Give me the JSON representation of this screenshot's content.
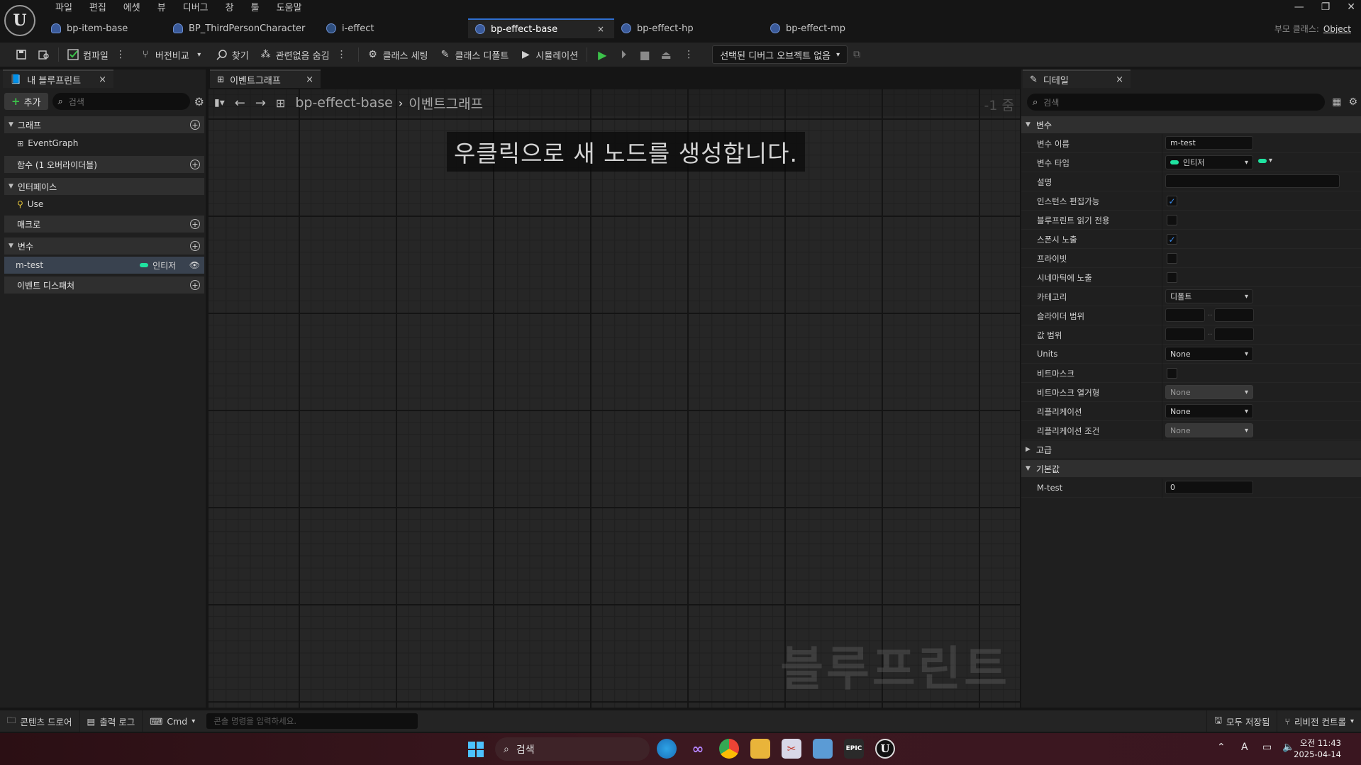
{
  "menu": [
    "파일",
    "편집",
    "에셋",
    "뷰",
    "디버그",
    "창",
    "툴",
    "도움말"
  ],
  "logo": "U",
  "doc_tabs": [
    {
      "label": "bp-item-base",
      "active": false,
      "close": ""
    },
    {
      "label": "BP_ThirdPersonCharacter",
      "active": false,
      "close": ""
    },
    {
      "label": "i-effect",
      "active": false,
      "close": ""
    },
    {
      "label": "bp-effect-base",
      "active": true,
      "close": "×"
    },
    {
      "label": "bp-effect-hp",
      "active": false,
      "close": ""
    },
    {
      "label": "bp-effect-mp",
      "active": false,
      "close": ""
    }
  ],
  "window_controls": {
    "minimize": "—",
    "restore": "❐",
    "close": "✕"
  },
  "parent_class": {
    "label": "부모 클래스:",
    "value": "Object"
  },
  "toolbar": {
    "compile": "컴파일",
    "diff": "버전비교",
    "find": "찾기",
    "hide_unrelated": "관련없음 숨김",
    "class_settings": "클래스 세팅",
    "class_defaults": "클래스 디폴트",
    "simulation": "시뮬레이션",
    "debug_object": "선택된 디버그 오브젝트 없음",
    "colors": {
      "play": "#3cc24a"
    }
  },
  "my_blueprint": {
    "tab_label": "내 블루프린트",
    "tab_close": "×",
    "add_label": "추가",
    "search_placeholder": "검색",
    "sections": {
      "graph": "그래프",
      "graph_item": "EventGraph",
      "functions": "함수 (1 오버라이더블)",
      "interfaces": "인터페이스",
      "interface_item": "Use",
      "macros": "매크로",
      "variables": "변수",
      "event_dispatchers": "이벤트 디스패처"
    },
    "variable": {
      "name": "m-test",
      "type": "인티저",
      "type_color": "#1fe3a0"
    }
  },
  "graph": {
    "tab_label": "이벤트그래프",
    "tab_close": "×",
    "breadcrumb_root": "bp-effect-base",
    "breadcrumb_current": "이벤트그래프",
    "breadcrumb_sep": "›",
    "zoom": "-1 줌",
    "hint": "우클릭으로 새 노드를 생성합니다.",
    "watermark": "블루프린트"
  },
  "details": {
    "tab_label": "디테일",
    "tab_close": "×",
    "search_placeholder": "검색",
    "section_variable": "변수",
    "props": {
      "var_name_label": "변수 이름",
      "var_name_value": "m-test",
      "var_type_label": "변수 타입",
      "var_type_value": "인티저",
      "desc_label": "설명",
      "desc_value": "",
      "instance_editable_label": "인스턴스 편집가능",
      "bp_readonly_label": "블루프린트 읽기 전용",
      "expose_spawn_label": "스폰시 노출",
      "private_label": "프라이빗",
      "expose_cinematic_label": "시네마틱에 노출",
      "category_label": "카테고리",
      "category_value": "디폴트",
      "slider_range_label": "슬라이더 범위",
      "value_range_label": "값 범위",
      "range_sep": "..",
      "units_label": "Units",
      "units_value": "None",
      "bitmask_label": "비트마스크",
      "bitmask_enum_label": "비트마스크 열거형",
      "bitmask_enum_value": "None",
      "replication_label": "리플리케이션",
      "replication_value": "None",
      "replication_cond_label": "리플리케이션 조건",
      "replication_cond_value": "None"
    },
    "checkboxes": {
      "instance_editable": true,
      "bp_readonly": false,
      "expose_spawn": true,
      "private": false,
      "expose_cinematic": false,
      "bitmask": false
    },
    "section_advanced": "고급",
    "section_default": "기본값",
    "default_label": "M-test",
    "default_value": "0"
  },
  "statusbar": {
    "content_drawer": "콘텐츠 드로어",
    "output_log": "출력 로그",
    "cmd": "Cmd",
    "console_placeholder": "콘솔 명령을 입력하세요.",
    "save_all": "모두 저장됨",
    "revision_control": "리비전 컨트롤"
  },
  "taskbar": {
    "search_placeholder": "검색",
    "time": "오전 11:43",
    "date": "2025-04-14",
    "ime": "A"
  }
}
